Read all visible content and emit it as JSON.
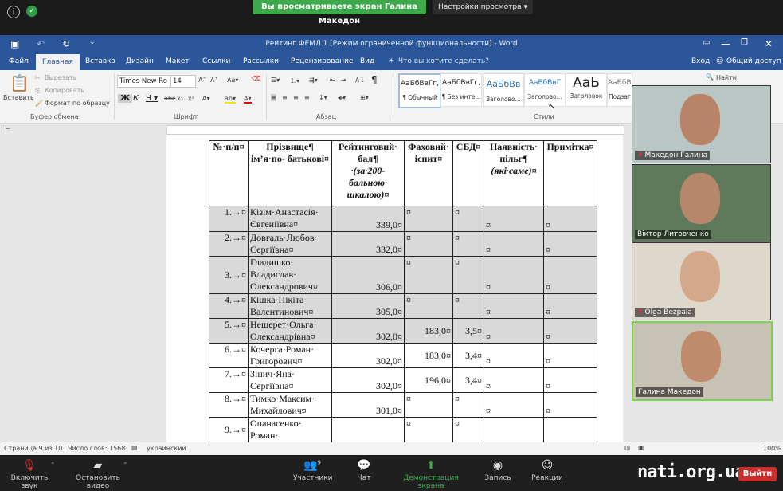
{
  "zoom": {
    "banner": "Вы просматриваете экран Галина Македон",
    "view_options": "Настройки просмотра ▾",
    "bottom": {
      "unmute": "Включить звук",
      "stop_video": "Остановить видео",
      "participants": "Участники",
      "participants_count": "9",
      "chat": "Чат",
      "share": "Демонстрация экрана",
      "record": "Запись",
      "reactions": "Реакции",
      "leave": "Выйти"
    },
    "participants": [
      {
        "name": "Македон Галина",
        "muted": true
      },
      {
        "name": "Віктор Литовченко",
        "muted": false
      },
      {
        "name": "Olga Bezpala",
        "muted": true
      },
      {
        "name": "Галина Македон",
        "muted": false
      }
    ],
    "watermark": "nati.org.ua"
  },
  "word": {
    "title": "Рейтинг ФЕМЛ 1 [Режим ограниченной функциональности] - Word",
    "tabs": [
      "Файл",
      "Главная",
      "Вставка",
      "Дизайн",
      "Макет",
      "Ссылки",
      "Рассылки",
      "Рецензирование",
      "Вид"
    ],
    "tell_me": "Что вы хотите сделать?",
    "signin": "Вход",
    "share": "Общий доступ",
    "clipboard": {
      "paste": "Вставить",
      "cut": "Вырезать",
      "copy": "Копировать",
      "format_painter": "Формат по образцу",
      "label": "Буфер обмена"
    },
    "font": {
      "name": "Times New Ro",
      "size": "14",
      "label": "Шрифт"
    },
    "paragraph_label": "Абзац",
    "styles": {
      "label": "Стили",
      "items": [
        {
          "preview": "АаБбВвГг,",
          "name": "¶ Обычный"
        },
        {
          "preview": "АаБбВвГг,",
          "name": "¶ Без инте..."
        },
        {
          "preview": "АаБбВв",
          "name": "Заголово..."
        },
        {
          "preview": "АаБбВвГ",
          "name": "Заголово..."
        },
        {
          "preview": "АаЬ",
          "name": "Заголовок"
        },
        {
          "preview": "АаБбВвГ",
          "name": "Подзаг"
        }
      ]
    },
    "find": "Найти",
    "status": {
      "page": "Страница 9 из 10",
      "words": "Число слов: 1568",
      "lang": "украинский",
      "zoom": "100%"
    }
  },
  "table": {
    "headers": [
      "№·п/п¤",
      "Прізвище¶ ім’я·по- батькові¤",
      "Рейтинговий· бал¶",
      "Фаховий· іспит¤",
      "СБД¤",
      "Наявність· пільг¶",
      "Примітка¤"
    ],
    "header_sub": {
      "score": "·(за·200- бальною· шкалою)¤",
      "benefits": "(які·саме)¤"
    },
    "rows": [
      {
        "n": "1.→¤",
        "name": "Кізім·Анастасія· Євгеніївна¤",
        "score": "339,0¤",
        "exam": "¤",
        "sbd": "¤",
        "ben": "¤",
        "note": "¤"
      },
      {
        "n": "2.→¤",
        "name": "Довгаль·Любов· Сергіївна¤",
        "score": "332,0¤",
        "exam": "¤",
        "sbd": "¤",
        "ben": "¤",
        "note": "¤"
      },
      {
        "n": "3.→¤",
        "name": "Гладишко· Владислав· Олександрович¤",
        "score": "306,0¤",
        "exam": "¤",
        "sbd": "¤",
        "ben": "¤",
        "note": "¤"
      },
      {
        "n": "4.→¤",
        "name": "Кішка·Нікіта· Валентинович¤",
        "score": "305,0¤",
        "exam": "¤",
        "sbd": "¤",
        "ben": "¤",
        "note": "¤"
      },
      {
        "n": "5.→¤",
        "name": "Нещерет·Ольга· Олександрівна¤",
        "score": "302,0¤",
        "exam": "183,0¤",
        "sbd": "3,5¤",
        "ben": "¤",
        "note": "¤"
      },
      {
        "n": "6.→¤",
        "name": "Кочерга·Роман· Григорович¤",
        "score": "302,0¤",
        "exam": "183,0¤",
        "sbd": "3,4¤",
        "ben": "¤",
        "note": "¤"
      },
      {
        "n": "7.→¤",
        "name": "Зінич·Яна· Сергіївна¤",
        "score": "302,0¤",
        "exam": "196,0¤",
        "sbd": "3,4¤",
        "ben": "¤",
        "note": "¤"
      },
      {
        "n": "8.→¤",
        "name": "Тимко·Максим· Михайлович¤",
        "score": "301,0¤",
        "exam": "¤",
        "sbd": "¤",
        "ben": "¤",
        "note": "¤"
      },
      {
        "n": "9.→¤",
        "name": "Опанасенко· Роман·",
        "score": "",
        "exam": "¤",
        "sbd": "¤",
        "ben": "",
        "note": ""
      }
    ]
  }
}
